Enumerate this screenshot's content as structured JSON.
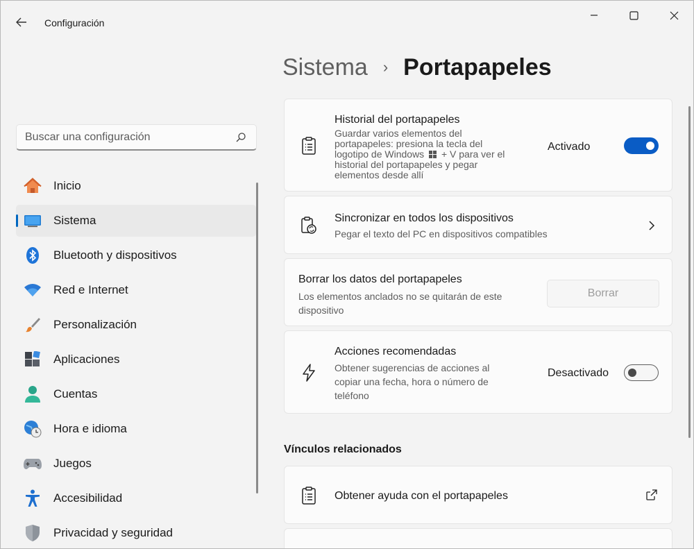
{
  "window": {
    "app_title": "Configuración",
    "controls": [
      "minimize",
      "maximize",
      "close"
    ]
  },
  "breadcrumb": {
    "parent": "Sistema",
    "separator": "›",
    "current": "Portapapeles"
  },
  "search": {
    "placeholder": "Buscar una configuración"
  },
  "sidebar": {
    "items": [
      {
        "label": "Inicio",
        "icon": "home-icon"
      },
      {
        "label": "Sistema",
        "icon": "system-display-icon",
        "selected": true
      },
      {
        "label": "Bluetooth y dispositivos",
        "icon": "bluetooth-icon"
      },
      {
        "label": "Red e Internet",
        "icon": "wifi-icon"
      },
      {
        "label": "Personalización",
        "icon": "paintbrush-icon"
      },
      {
        "label": "Aplicaciones",
        "icon": "apps-icon"
      },
      {
        "label": "Cuentas",
        "icon": "account-icon"
      },
      {
        "label": "Hora e idioma",
        "icon": "globe-clock-icon"
      },
      {
        "label": "Juegos",
        "icon": "gamepad-icon"
      },
      {
        "label": "Accesibilidad",
        "icon": "accessibility-icon"
      },
      {
        "label": "Privacidad y seguridad",
        "icon": "shield-icon"
      }
    ]
  },
  "cards": {
    "history": {
      "title": "Historial del portapapeles",
      "desc_line1": "Guardar varios elementos del",
      "desc_line2": "portapapeles: presiona la tecla del",
      "desc_line3a": "logotipo de Windows",
      "desc_line3b": "+ V para ver el",
      "desc_line4": "historial del portapapeles y pegar",
      "desc_line5": "elementos desde allí",
      "state": "Activado",
      "toggle_on": true
    },
    "sync": {
      "title": "Sincronizar en todos los dispositivos",
      "desc": "Pegar el texto del PC en dispositivos compatibles"
    },
    "clear": {
      "title": "Borrar los datos del portapapeles",
      "desc_line1": "Los elementos anclados no se quitarán de este",
      "desc_line2": "dispositivo",
      "button": "Borrar"
    },
    "suggested": {
      "title": "Acciones recomendadas",
      "desc_line1": "Obtener sugerencias de acciones al",
      "desc_line2": "copiar una fecha, hora o número de",
      "desc_line3": "teléfono",
      "state": "Desactivado",
      "toggle_on": false
    }
  },
  "related": {
    "section_title": "Vínculos relacionados",
    "help_link": "Obtener ayuda con el portapapeles"
  },
  "colors": {
    "accent": "#0a5cc5",
    "background": "#f3f3f3",
    "card": "#fbfbfb"
  }
}
